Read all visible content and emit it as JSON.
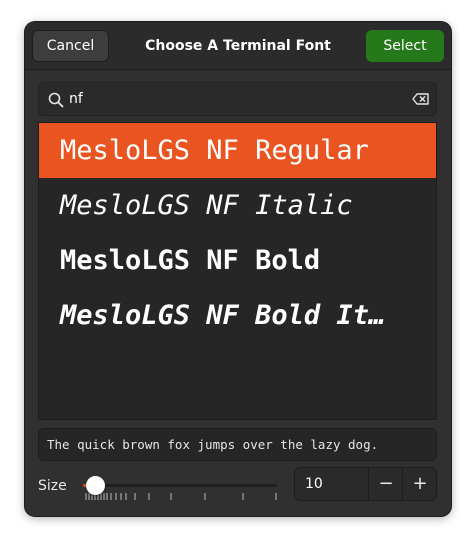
{
  "header": {
    "cancel_label": "Cancel",
    "title": "Choose A Terminal Font",
    "select_label": "Select"
  },
  "search": {
    "value": "nf"
  },
  "fonts": [
    {
      "label": "MesloLGS NF Regular",
      "selected": true
    },
    {
      "label": "MesloLGS NF Italic",
      "selected": false
    },
    {
      "label": "MesloLGS NF Bold",
      "selected": false
    },
    {
      "label": "MesloLGS NF Bold It…",
      "selected": false
    }
  ],
  "preview_text": "The quick brown fox jumps over the lazy dog.",
  "size": {
    "label": "Size",
    "value": "10",
    "minus": "−",
    "plus": "+"
  },
  "colors": {
    "accent": "#e95420",
    "select_button": "#26791a",
    "dialog_bg": "#303030"
  },
  "icons": {
    "search": "search-icon",
    "clear": "backspace-clear-icon"
  }
}
